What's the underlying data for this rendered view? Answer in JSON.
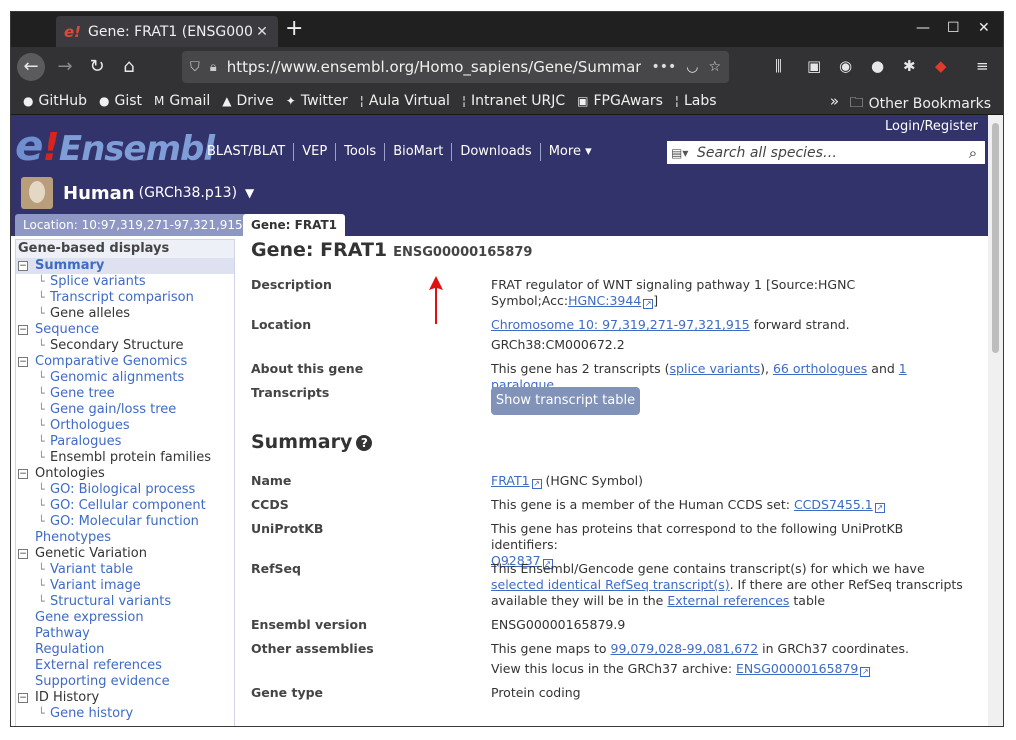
{
  "browser": {
    "tab_title": "Gene: FRAT1 (ENSG0000",
    "tab_favicon": "e!",
    "new_tab": "+",
    "url": "https://www.ensembl.org/Homo_sapiens/Gene/Summary",
    "url_more": "•••",
    "window_controls": [
      "—",
      "☐",
      "✕"
    ]
  },
  "bookmarks": [
    {
      "label": "GitHub",
      "icon": "github-icon"
    },
    {
      "label": "Gist",
      "icon": "github-icon"
    },
    {
      "label": "Gmail",
      "icon": "mail-icon"
    },
    {
      "label": "Drive",
      "icon": "drive-icon"
    },
    {
      "label": "Twitter",
      "icon": "twitter-icon"
    },
    {
      "label": "Aula Virtual",
      "icon": "urjc-icon"
    },
    {
      "label": "Intranet URJC",
      "icon": "urjc-icon"
    },
    {
      "label": "FPGAwars",
      "icon": "fpga-icon"
    },
    {
      "label": "Labs",
      "icon": "urjc-icon"
    }
  ],
  "bookmarks_other": "Other Bookmarks",
  "site": {
    "logo_e": "e",
    "logo_bang": "!",
    "logo_text": "Ensembl",
    "login": "Login/Register",
    "nav": [
      "BLAST/BLAT",
      "VEP",
      "Tools",
      "BioMart",
      "Downloads",
      "More ▾"
    ],
    "search_placeholder": "Search all species…",
    "species_name": "Human",
    "species_assembly": "(GRCh38.p13)",
    "location_tab": "Location: 10:97,319,271-97,321,915",
    "gene_tab": "Gene: FRAT1"
  },
  "sidebar": {
    "header": "Gene-based displays",
    "items": [
      {
        "label": "Summary",
        "level": 0,
        "toggle": "−",
        "link": true,
        "selected": true
      },
      {
        "label": "Splice variants",
        "level": 1,
        "link": true
      },
      {
        "label": "Transcript comparison",
        "level": 1,
        "link": true
      },
      {
        "label": "Gene alleles",
        "level": 1,
        "link": false
      },
      {
        "label": "Sequence",
        "level": 0,
        "toggle": "−",
        "link": true
      },
      {
        "label": "Secondary Structure",
        "level": 1,
        "link": false
      },
      {
        "label": "Comparative Genomics",
        "level": 0,
        "toggle": "−",
        "link": true
      },
      {
        "label": "Genomic alignments",
        "level": 1,
        "link": true
      },
      {
        "label": "Gene tree",
        "level": 1,
        "link": true
      },
      {
        "label": "Gene gain/loss tree",
        "level": 1,
        "link": true
      },
      {
        "label": "Orthologues",
        "level": 1,
        "link": true
      },
      {
        "label": "Paralogues",
        "level": 1,
        "link": true
      },
      {
        "label": "Ensembl protein families",
        "level": 1,
        "link": false
      },
      {
        "label": "Ontologies",
        "level": 0,
        "toggle": "−",
        "link": false
      },
      {
        "label": "GO: Biological process",
        "level": 1,
        "link": true
      },
      {
        "label": "GO: Cellular component",
        "level": 1,
        "link": true
      },
      {
        "label": "GO: Molecular function",
        "level": 1,
        "link": true
      },
      {
        "label": "Phenotypes",
        "level": 0,
        "link": true
      },
      {
        "label": "Genetic Variation",
        "level": 0,
        "toggle": "−",
        "link": false
      },
      {
        "label": "Variant table",
        "level": 1,
        "link": true
      },
      {
        "label": "Variant image",
        "level": 1,
        "link": true
      },
      {
        "label": "Structural variants",
        "level": 1,
        "link": true
      },
      {
        "label": "Gene expression",
        "level": 0,
        "link": true
      },
      {
        "label": "Pathway",
        "level": 0,
        "link": true
      },
      {
        "label": "Regulation",
        "level": 0,
        "link": true
      },
      {
        "label": "External references",
        "level": 0,
        "link": true
      },
      {
        "label": "Supporting evidence",
        "level": 0,
        "link": true
      },
      {
        "label": "ID History",
        "level": 0,
        "toggle": "−",
        "link": false
      },
      {
        "label": "Gene history",
        "level": 1,
        "link": true
      }
    ]
  },
  "gene": {
    "title": "Gene: FRAT1",
    "id": "ENSG00000165879",
    "description_label": "Description",
    "description_1": "FRAT regulator of WNT signaling pathway 1 [Source:HGNC",
    "description_2a": "Symbol;Acc:",
    "description_link": "HGNC:3944",
    "description_2b": "]",
    "location_label": "Location",
    "location_link": "Chromosome 10: 97,319,271-97,321,915",
    "location_strand": " forward strand.",
    "location_assembly": "GRCh38:CM000672.2",
    "about_label": "About this gene",
    "about_prefix": "This gene has 2 transcripts (",
    "about_splice": "splice variants",
    "about_sep1": "), ",
    "about_orthologues": "66 orthologues",
    "about_sep2": " and ",
    "about_paralogue": "1 paralogue",
    "about_end": ".",
    "transcripts_label": "Transcripts",
    "transcripts_button": "Show transcript table"
  },
  "summary": {
    "heading": "Summary",
    "help": "?",
    "name_label": "Name",
    "name_link": "FRAT1",
    "name_rest": " (HGNC Symbol)",
    "ccds_label": "CCDS",
    "ccds_text": "This gene is a member of the Human CCDS set: ",
    "ccds_link": "CCDS7455.1",
    "uniprot_label": "UniProtKB",
    "uniprot_text": "This gene has proteins that correspond to the following UniProtKB identifiers:",
    "uniprot_link": "Q92837",
    "refseq_label": "RefSeq",
    "refseq_text1": "This Ensembl/Gencode gene contains transcript(s) for which we have ",
    "refseq_link1": "selected identical RefSeq transcript(s)",
    "refseq_text2": ". If there are other RefSeq transcripts available they will be in the ",
    "refseq_link2": "External references",
    "refseq_text3": " table",
    "version_label": "Ensembl version",
    "version_value": "ENSG00000165879.9",
    "other_label": "Other assemblies",
    "other_text1": "This gene maps to ",
    "other_link1": "99,079,028-99,081,672",
    "other_text2": " in GRCh37 coordinates.",
    "other_text3": "View this locus in the GRCh37 archive: ",
    "other_link2": "ENSG00000165879",
    "type_label": "Gene type",
    "type_value": "Protein coding"
  },
  "colors": {
    "masthead": "#33336b",
    "link": "#3e6bc4",
    "annotation_arrow": "#e01010"
  }
}
